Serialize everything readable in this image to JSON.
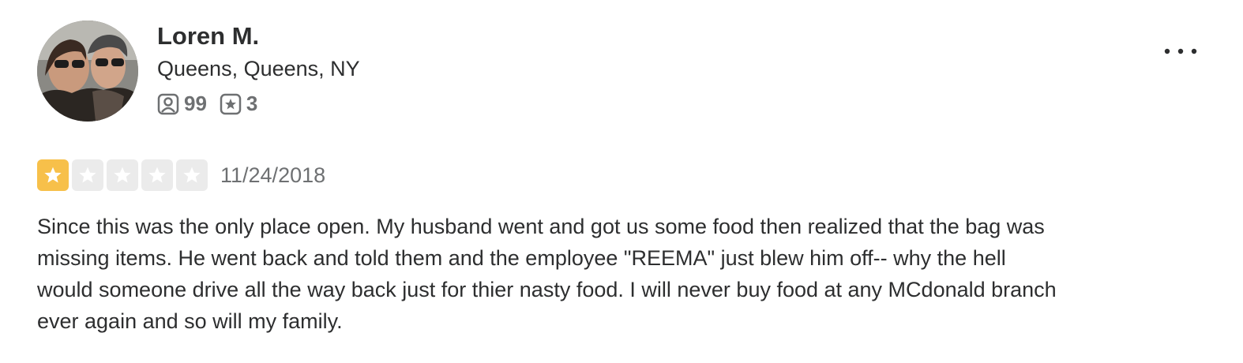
{
  "reviewer": {
    "name": "Loren M.",
    "location": "Queens, Queens, NY",
    "friends_count": "99",
    "reviews_count": "3",
    "friends_icon": "friends-icon",
    "reviews_icon": "star-badge-icon"
  },
  "review": {
    "rating": 1,
    "max_rating": 5,
    "date": "11/24/2018",
    "text": "Since this was the only place open. My husband went and got us some food then realized that the bag was missing items. He went back and told them and the employee \"REEMA\" just blew him off-- why the hell would someone drive all the way back just for thier nasty food. I will never buy food at any MCdonald branch ever again and so will my family."
  },
  "menu": {
    "icon": "more-options-icon"
  },
  "colors": {
    "star_filled": "#f7c04a",
    "star_empty": "#ebebeb",
    "text_primary": "#2d2e2f",
    "text_secondary": "#6e7072"
  }
}
